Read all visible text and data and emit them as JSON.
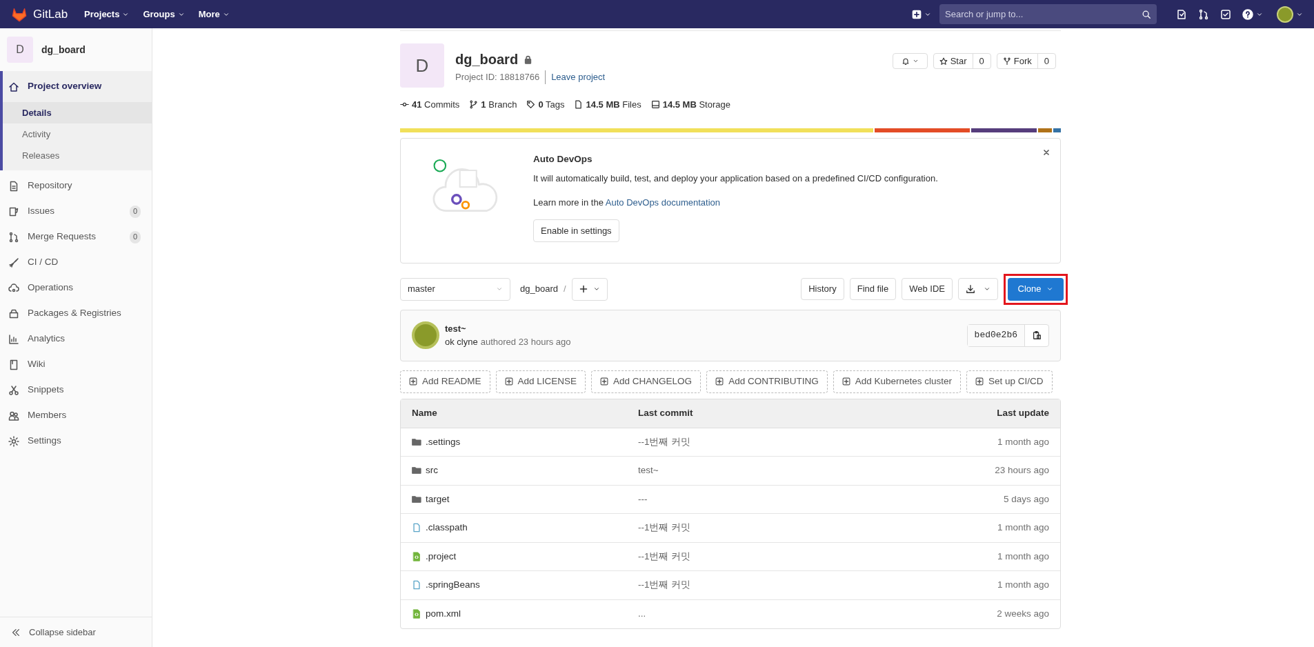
{
  "navbar": {
    "brand": "GitLab",
    "menus": [
      "Projects",
      "Groups",
      "More"
    ],
    "search": {
      "placeholder": "Search or jump to..."
    }
  },
  "sidebar": {
    "project_letter": "D",
    "project_name": "dg_board",
    "items": [
      {
        "label": "Project overview",
        "selected": true,
        "expanded": true,
        "children": [
          {
            "label": "Details",
            "selected": true
          },
          {
            "label": "Activity",
            "selected": false
          },
          {
            "label": "Releases",
            "selected": false
          }
        ]
      },
      {
        "label": "Repository",
        "selected": false
      },
      {
        "label": "Issues",
        "selected": false,
        "count": "0"
      },
      {
        "label": "Merge Requests",
        "selected": false,
        "count": "0"
      },
      {
        "label": "CI / CD",
        "selected": false
      },
      {
        "label": "Operations",
        "selected": false
      },
      {
        "label": "Packages & Registries",
        "selected": false
      },
      {
        "label": "Analytics",
        "selected": false
      },
      {
        "label": "Wiki",
        "selected": false
      },
      {
        "label": "Snippets",
        "selected": false
      },
      {
        "label": "Members",
        "selected": false
      },
      {
        "label": "Settings",
        "selected": false
      }
    ],
    "collapse": "Collapse sidebar"
  },
  "project": {
    "letter": "D",
    "name": "dg_board",
    "private": true,
    "project_id": "Project ID: 18818766",
    "leave": "Leave project",
    "star": {
      "label": "Star",
      "count": "0"
    },
    "fork": {
      "label": "Fork",
      "count": "0"
    },
    "stats": [
      {
        "value": "41",
        "label": "Commits"
      },
      {
        "value": "1",
        "label": "Branch"
      },
      {
        "value": "0",
        "label": "Tags"
      },
      {
        "value": "14.5 MB",
        "label": "Files"
      },
      {
        "value": "14.5 MB",
        "label": "Storage"
      }
    ],
    "languages": [
      {
        "color": "#f1e05a"
      },
      {
        "color": "#e34c26"
      },
      {
        "color": "#563d7c"
      },
      {
        "color": "#b07219"
      },
      {
        "color": "#3572a5"
      }
    ]
  },
  "auto_devops": {
    "title": "Auto DevOps",
    "description": "It will automatically build, test, and deploy your application based on a predefined CI/CD configuration.",
    "learn_more": "Learn more in the",
    "link": "Auto DevOps documentation",
    "button": "Enable in settings"
  },
  "toolbar": {
    "branch": "master",
    "path": "dg_board",
    "separator": "/",
    "buttons": [
      "History",
      "Find file",
      "Web IDE"
    ],
    "clone": {
      "label": "Clone",
      "highlighted": true
    }
  },
  "last_commit": {
    "title": "test~",
    "author": "ok clyne",
    "meta": "authored 23 hours ago",
    "sha": "bed0e2b6"
  },
  "add_buttons": [
    "Add README",
    "Add LICENSE",
    "Add CHANGELOG",
    "Add CONTRIBUTING",
    "Add Kubernetes cluster",
    "Set up CI/CD"
  ],
  "table": {
    "columns": [
      "Name",
      "Last commit",
      "Last update"
    ],
    "rows": [
      {
        "kind": "folder",
        "name": ".settings",
        "commit": "--1번째 커밋",
        "updated": "1 month ago"
      },
      {
        "kind": "folder",
        "name": "src",
        "commit": "test~",
        "updated": "23 hours ago"
      },
      {
        "kind": "folder",
        "name": "target",
        "commit": "---",
        "updated": "5 days ago"
      },
      {
        "kind": "file",
        "name": ".classpath",
        "commit": "--1번째 커밋",
        "updated": "1 month ago"
      },
      {
        "kind": "code",
        "name": ".project",
        "commit": "--1번째 커밋",
        "updated": "1 month ago"
      },
      {
        "kind": "file",
        "name": ".springBeans",
        "commit": "--1번째 커밋",
        "updated": "1 month ago"
      },
      {
        "kind": "code",
        "name": "pom.xml",
        "commit": "...",
        "updated": "2 weeks ago"
      }
    ]
  }
}
